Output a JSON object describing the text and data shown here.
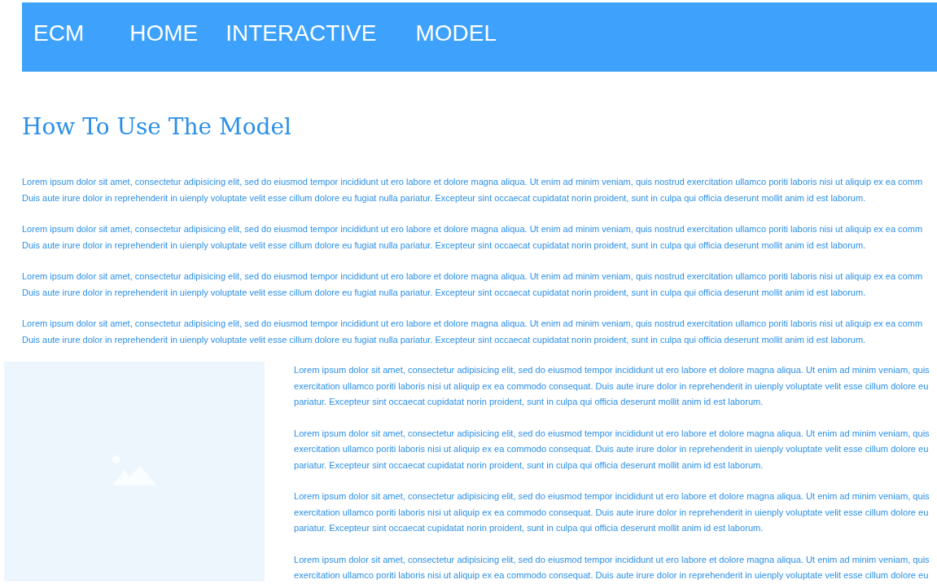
{
  "navbar": {
    "brand": "ECM",
    "links": [
      {
        "label": "HOME"
      },
      {
        "label": "INTERACTIVE"
      },
      {
        "label": "MODEL"
      }
    ]
  },
  "heading": "How To Use The Model",
  "intro_paragraphs": [
    {
      "lines": [
        "Lorem ipsum dolor sit amet, consectetur adipisicing elit, sed do eiusmod tempor incididunt ut ero labore et dolore magna aliqua. Ut enim ad minim veniam, quis nostrud exercitation ullamco poriti laboris nisi ut aliquip ex ea comm",
        "Duis aute irure dolor in reprehenderit in uienply voluptate velit esse cillum dolore eu fugiat nulla pariatur. Excepteur sint occaecat cupidatat norin proident, sunt in culpa qui officia deserunt mollit anim id est laborum."
      ]
    },
    {
      "lines": [
        "Lorem ipsum dolor sit amet, consectetur adipisicing elit, sed do eiusmod tempor incididunt ut ero labore et dolore magna aliqua. Ut enim ad minim veniam, quis nostrud exercitation ullamco poriti laboris nisi ut aliquip ex ea comm",
        "Duis aute irure dolor in reprehenderit in uienply voluptate velit esse cillum dolore eu fugiat nulla pariatur. Excepteur sint occaecat cupidatat norin proident, sunt in culpa qui officia deserunt mollit anim id est laborum."
      ]
    },
    {
      "lines": [
        "Lorem ipsum dolor sit amet, consectetur adipisicing elit, sed do eiusmod tempor incididunt ut ero labore et dolore magna aliqua. Ut enim ad minim veniam, quis nostrud exercitation ullamco poriti laboris nisi ut aliquip ex ea comm",
        "Duis aute irure dolor in reprehenderit in uienply voluptate velit esse cillum dolore eu fugiat nulla pariatur. Excepteur sint occaecat cupidatat norin proident, sunt in culpa qui officia deserunt mollit anim id est laborum."
      ]
    },
    {
      "lines": [
        "Lorem ipsum dolor sit amet, consectetur adipisicing elit, sed do eiusmod tempor incididunt ut ero labore et dolore magna aliqua. Ut enim ad minim veniam, quis nostrud exercitation ullamco poriti laboris nisi ut aliquip ex ea comm",
        "Duis aute irure dolor in reprehenderit in uienply voluptate velit esse cillum dolore eu fugiat nulla pariatur. Excepteur sint occaecat cupidatat norin proident, sunt in culpa qui officia deserunt mollit anim id est laborum."
      ]
    }
  ],
  "side_paragraphs": [
    {
      "lines": [
        "Lorem ipsum dolor sit amet, consectetur adipisicing elit, sed do eiusmod tempor incididunt ut ero labore et dolore magna aliqua. Ut enim ad minim veniam, quis",
        "exercitation ullamco poriti laboris nisi ut aliquip ex ea commodo consequat. Duis aute irure dolor in reprehenderit in uienply voluptate velit esse cillum dolore eu",
        "pariatur. Excepteur sint occaecat cupidatat norin proident, sunt in culpa qui officia deserunt mollit anim id est laborum."
      ]
    },
    {
      "lines": [
        "Lorem ipsum dolor sit amet, consectetur adipisicing elit, sed do eiusmod tempor incididunt ut ero labore et dolore magna aliqua. Ut enim ad minim veniam, quis",
        "exercitation ullamco poriti laboris nisi ut aliquip ex ea commodo consequat. Duis aute irure dolor in reprehenderit in uienply voluptate velit esse cillum dolore eu",
        "pariatur. Excepteur sint occaecat cupidatat norin proident, sunt in culpa qui officia deserunt mollit anim id est laborum."
      ]
    },
    {
      "lines": [
        "Lorem ipsum dolor sit amet, consectetur adipisicing elit, sed do eiusmod tempor incididunt ut ero labore et dolore magna aliqua. Ut enim ad minim veniam, quis",
        "exercitation ullamco poriti laboris nisi ut aliquip ex ea commodo consequat. Duis aute irure dolor in reprehenderit in uienply voluptate velit esse cillum dolore eu",
        "pariatur. Excepteur sint occaecat cupidatat norin proident, sunt in culpa qui officia deserunt mollit anim id est laborum."
      ]
    },
    {
      "lines": [
        "Lorem ipsum dolor sit amet, consectetur adipisicing elit, sed do eiusmod tempor incididunt ut ero labore et dolore magna aliqua. Ut enim ad minim veniam, quis",
        "exercitation ullamco poriti laboris nisi ut aliquip ex ea commodo consequat. Duis aute irure dolor in reprehenderit in uienply voluptate velit esse cillum dolore eu"
      ]
    }
  ]
}
